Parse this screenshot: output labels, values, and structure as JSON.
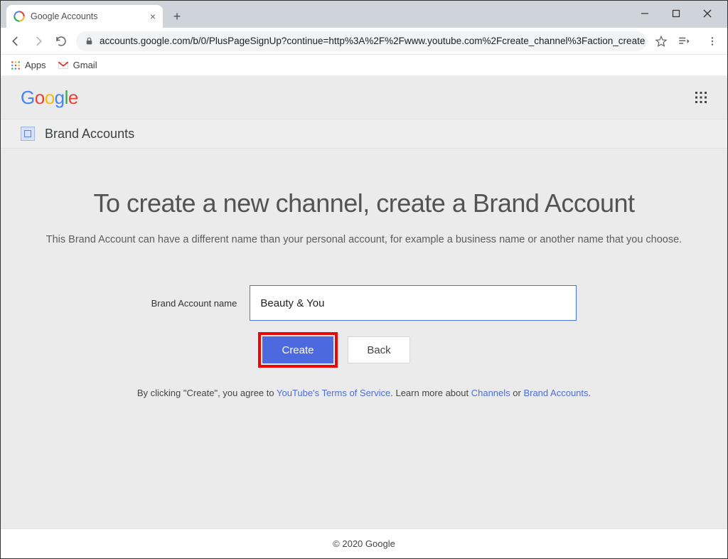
{
  "browser": {
    "tab_title": "Google Accounts",
    "url": "accounts.google.com/b/0/PlusPageSignUp?continue=http%3A%2F%2Fwww.youtube.com%2Fcreate_channel%3Faction_create_…",
    "bookmarks": {
      "apps": "Apps",
      "gmail": "Gmail"
    }
  },
  "header": {
    "logo": "Google"
  },
  "subheader": {
    "title": "Brand Accounts"
  },
  "content": {
    "title": "To create a new channel, create a Brand Account",
    "description": "This Brand Account can have a different name than your personal account, for example a business name or another name that you choose.",
    "form": {
      "label": "Brand Account name",
      "value": "Beauty & You",
      "create_label": "Create",
      "back_label": "Back"
    },
    "terms": {
      "prefix": "By clicking \"Create\", you agree to ",
      "link1": "YouTube's Terms of Service",
      "mid": ". Learn more about ",
      "link2": "Channels",
      "or": " or ",
      "link3": "Brand Accounts",
      "suffix": "."
    }
  },
  "footer": {
    "text": "© 2020 Google"
  }
}
